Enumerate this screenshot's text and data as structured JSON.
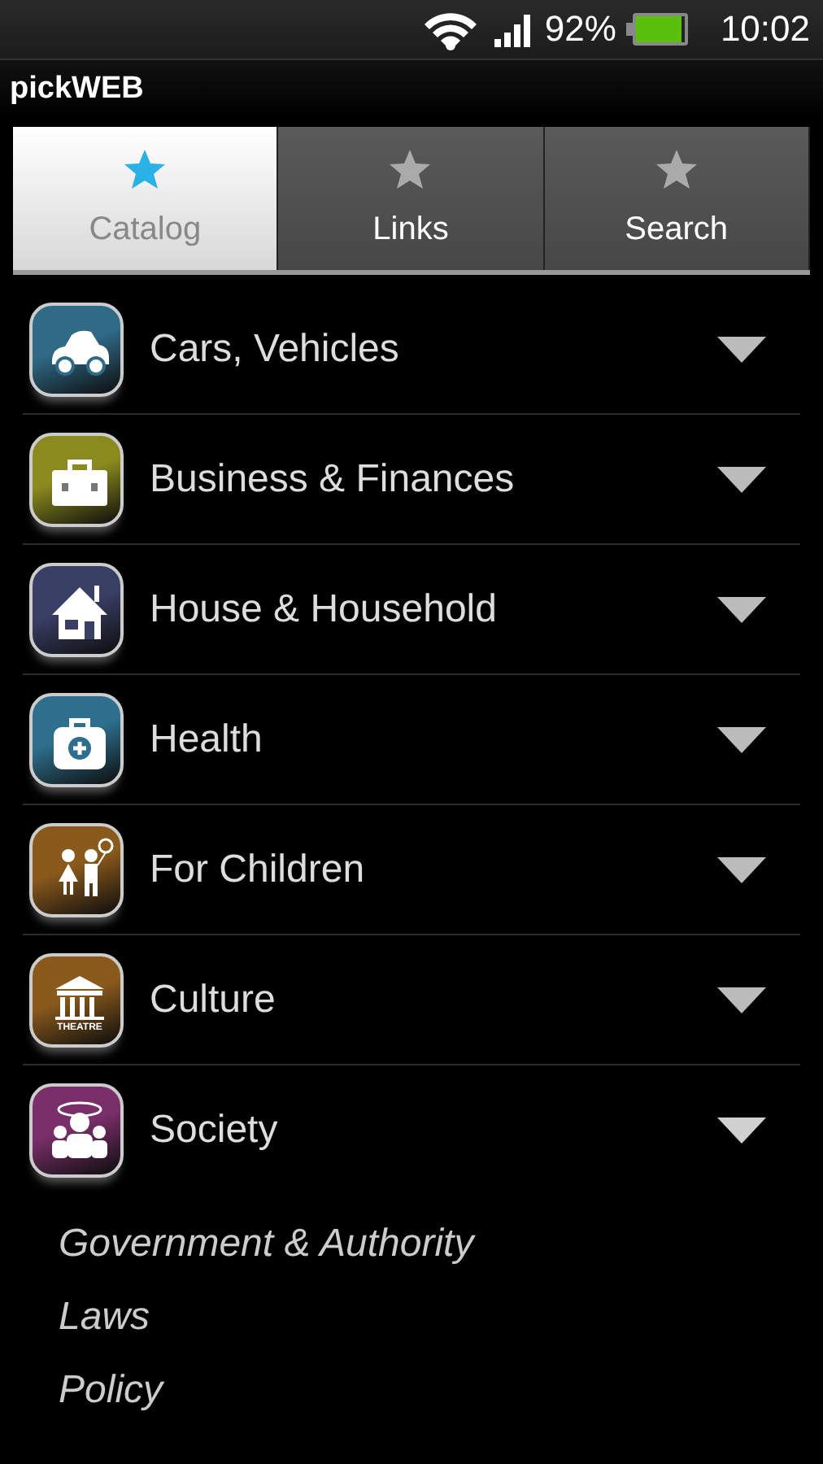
{
  "status_bar": {
    "battery_percent": "92%",
    "time": "10:02",
    "battery": {
      "level": 0.92
    }
  },
  "window": {
    "title": "pickWEB"
  },
  "tabs": [
    {
      "label": "Catalog",
      "selected": true
    },
    {
      "label": "Links",
      "selected": false
    },
    {
      "label": "Search",
      "selected": false
    }
  ],
  "categories": [
    {
      "label": "Cars, Vehicles",
      "color": "#2f6a86",
      "expanded": false
    },
    {
      "label": "Business & Finances",
      "color": "#8a8a1e",
      "expanded": false
    },
    {
      "label": "House & Household",
      "color": "#3a3f66",
      "expanded": false
    },
    {
      "label": "Health",
      "color": "#2d6f8c",
      "expanded": false
    },
    {
      "label": "For Children",
      "color": "#8a5a1c",
      "expanded": false
    },
    {
      "label": "Culture",
      "color": "#8a5a1c",
      "expanded": false,
      "icon_text": "THEATRE"
    },
    {
      "label": "Society",
      "color": "#7a2f6a",
      "expanded": true,
      "children": [
        {
          "label": "Government & Authority"
        },
        {
          "label": "Laws"
        },
        {
          "label": "Policy"
        }
      ]
    }
  ]
}
